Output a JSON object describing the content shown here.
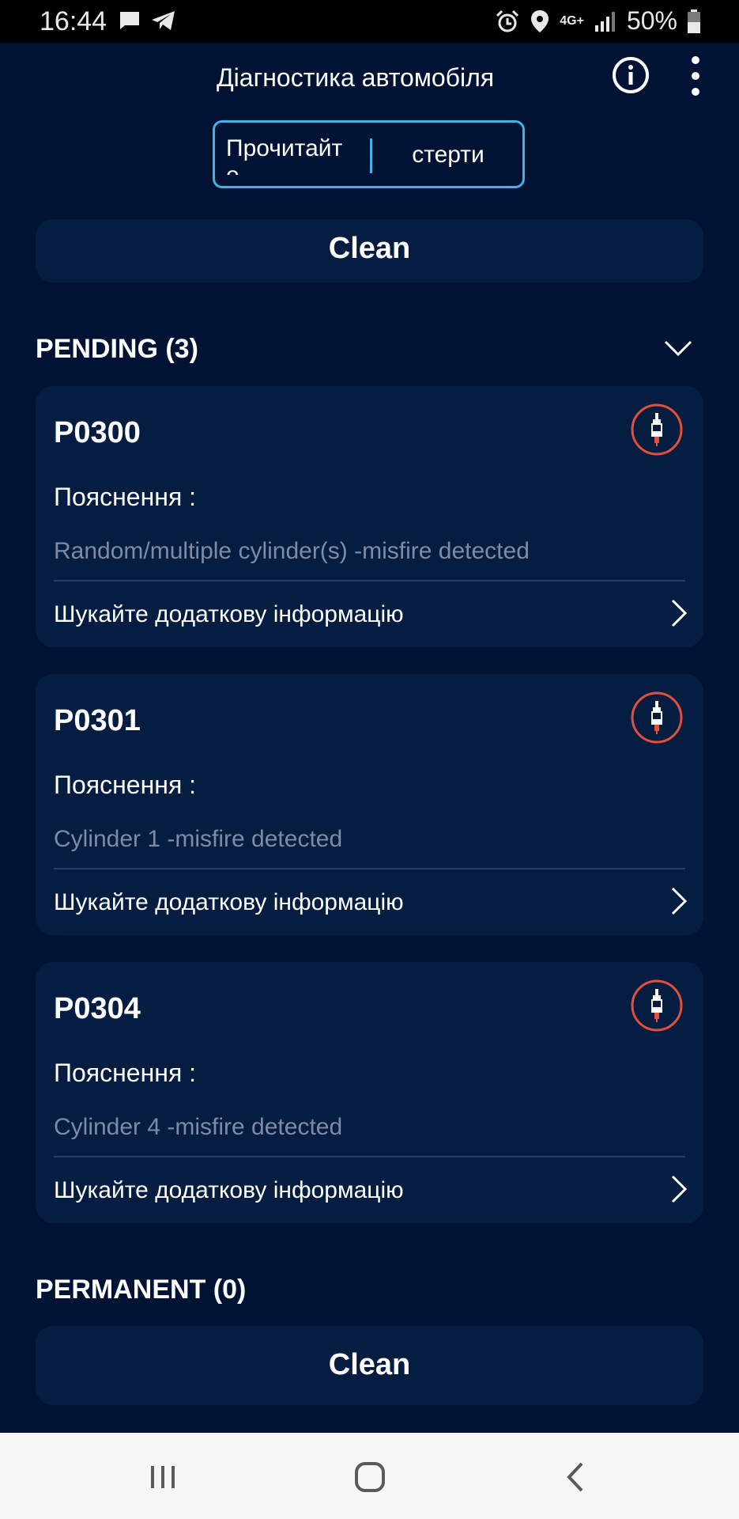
{
  "status_bar": {
    "time": "16:44",
    "battery_text": "50%",
    "network_label": "4G+",
    "icons": [
      "message-icon",
      "telegram-icon",
      "alarm-icon",
      "location-icon",
      "network-4g-icon",
      "signal-icon",
      "battery-icon"
    ]
  },
  "app_bar": {
    "title": "Діагностика автомобіля",
    "info_icon": "info-icon",
    "menu_icon": "more-vert-icon"
  },
  "segment": {
    "read_label": "Прочитайте",
    "erase_label": "стерти",
    "accent": "#3fb3e4"
  },
  "clean_label_top": "Clean",
  "pending": {
    "title": "PENDING (3)",
    "items": [
      {
        "code": "P0300",
        "explain_label": "Пояснення :",
        "description": "Random/multiple cylinder(s) -misfire detected",
        "more_label": "Шукайте додаткову інформацію"
      },
      {
        "code": "P0301",
        "explain_label": "Пояснення :",
        "description": "Cylinder 1 -misfire detected",
        "more_label": "Шукайте додаткову інформацію"
      },
      {
        "code": "P0304",
        "explain_label": "Пояснення :",
        "description": "Cylinder 4 -misfire detected",
        "more_label": "Шукайте додаткову інформацію"
      }
    ]
  },
  "permanent": {
    "title": "PERMANENT (0)",
    "clean_label": "Clean"
  },
  "colors": {
    "background": "#001334",
    "card": "#061d42",
    "icon_ring": "#e0503c",
    "muted_text": "#7d8ba5"
  }
}
